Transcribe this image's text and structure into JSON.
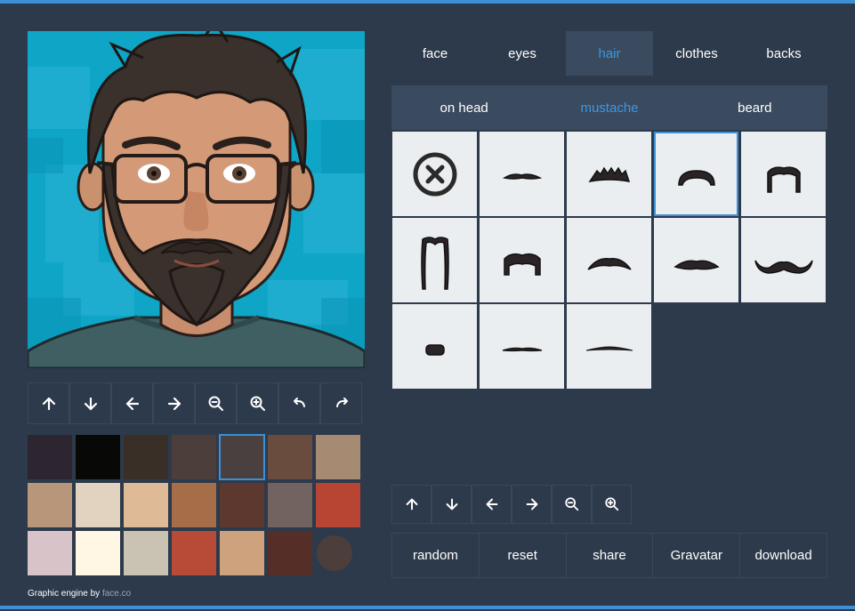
{
  "colors": {
    "accent": "#3d8fd6",
    "background": "#2d3a4b",
    "panel": "#3a4a5f",
    "cell": "#ebeef0"
  },
  "tabs": [
    {
      "label": "face"
    },
    {
      "label": "eyes"
    },
    {
      "label": "hair",
      "active": true
    },
    {
      "label": "clothes"
    },
    {
      "label": "backs"
    }
  ],
  "subtabs": [
    {
      "label": "on head"
    },
    {
      "label": "mustache",
      "active": true
    },
    {
      "label": "beard"
    }
  ],
  "mustache_options": [
    {
      "icon": "none-icon"
    },
    {
      "icon": "mustache-thin-icon"
    },
    {
      "icon": "mustache-jagged-icon"
    },
    {
      "icon": "mustache-arched-icon",
      "selected": true
    },
    {
      "icon": "mustache-horseshoe-icon"
    },
    {
      "icon": "mustache-long-horseshoe-icon"
    },
    {
      "icon": "mustache-thick-icon"
    },
    {
      "icon": "mustache-wide-arched-icon"
    },
    {
      "icon": "mustache-slim-icon"
    },
    {
      "icon": "mustache-handlebar-icon"
    },
    {
      "icon": "mustache-toothbrush-icon"
    },
    {
      "icon": "mustache-pencil-icon"
    },
    {
      "icon": "mustache-hairline-icon"
    }
  ],
  "preview_toolbar": [
    "arrow-up-icon",
    "arrow-down-icon",
    "arrow-left-icon",
    "arrow-right-icon",
    "zoom-out-icon",
    "zoom-in-icon",
    "undo-icon",
    "redo-icon"
  ],
  "item_toolbar": [
    "arrow-up-icon",
    "arrow-down-icon",
    "arrow-left-icon",
    "arrow-right-icon",
    "zoom-out-icon",
    "zoom-in-icon"
  ],
  "swatches": [
    "#2d2530",
    "#080806",
    "#3a2f27",
    "#4c3f3b",
    "#4a4040",
    "#6a4c3e",
    "#a68a72",
    "#b8967a",
    "#e2d2c0",
    "#deba96",
    "#a56e48",
    "#5c382e",
    "#726260",
    "#b84433",
    "#d8c4c8",
    "#fff6e4",
    "#cac2b2",
    "#b84a38",
    "#cda27c",
    "#552e28"
  ],
  "swatch_circle": "#4c3f3b",
  "selected_swatch": 4,
  "actions": {
    "random": "random",
    "reset": "reset",
    "share": "share",
    "gravatar": "Gravatar",
    "download": "download"
  },
  "credit": {
    "text": "Graphic engine by ",
    "link": "face.co"
  }
}
